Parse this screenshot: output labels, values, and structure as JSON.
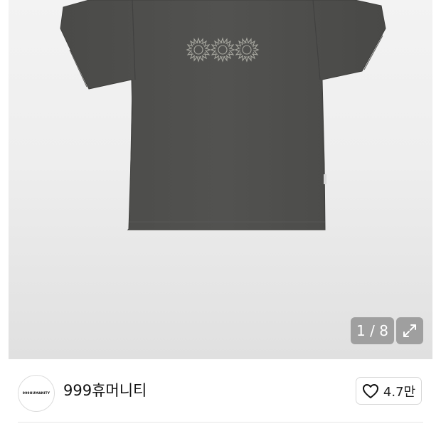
{
  "gallery": {
    "image_alt": "dark gray t-shirt with three embroidered sun motifs",
    "counter": "1 / 8",
    "expand_icon": "expand-arrows-icon"
  },
  "brand": {
    "logo_text": "999HUMANITY",
    "name": "999휴머니티"
  },
  "like": {
    "icon": "heart-outline-icon",
    "count": "4.7만"
  },
  "colors": {
    "shirt": "#4f4f4d",
    "background_top": "#f3f3f3",
    "background_bottom": "#e0e0e0",
    "overlay": "#8c8c8c"
  }
}
